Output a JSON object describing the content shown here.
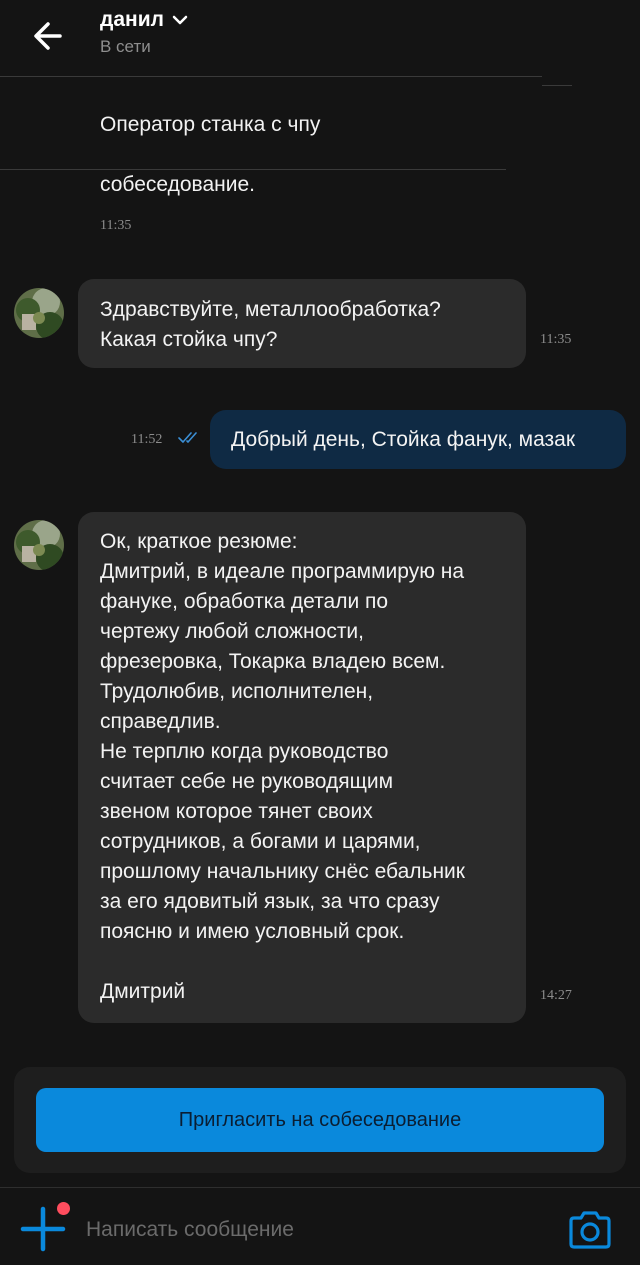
{
  "header": {
    "contact_name": "данил",
    "status": "В сети",
    "icons": [
      "arrow-left-icon",
      "chevron-down-icon"
    ]
  },
  "card": {
    "title": "Оператор станка с чпу",
    "text": "собеседование.",
    "time": "11:35"
  },
  "messages": [
    {
      "direction": "in",
      "lines": [
        "Здравствуйте, металлообработка?",
        "Какая стойка чпу?"
      ],
      "time": "11:35"
    },
    {
      "direction": "out",
      "text": "Добрый день, Стойка фанук, мазак",
      "time": "11:52",
      "status_icon": "double-check-icon"
    },
    {
      "direction": "in",
      "lines": [
        "Ок, краткое резюме:",
        "Дмитрий, в идеале программирую на",
        "фануке, обработка детали по",
        "чертежу любой сложности,",
        "фрезеровка, Токарка владею всем.",
        "Трудолюбив, исполнителен,",
        "справедлив.",
        "Не терплю когда руководство",
        "считает себе не руководящим",
        "звеном которое тянет своих",
        "сотрудников, а богами и царями,",
        "прошлому начальнику снёс ебальник",
        "за его ядовитый язык, за что сразу",
        "поясню и имею условный срок.",
        "",
        "Дмитрий"
      ],
      "time": "14:27"
    }
  ],
  "invite_button": {
    "label": "Пригласить на собеседование"
  },
  "composer": {
    "placeholder": "Написать сообщение",
    "icons": [
      "plus-icon",
      "camera-icon"
    ],
    "colors": {
      "accent": "#0a89dc",
      "notification_dot": "#ff4d5e"
    }
  }
}
